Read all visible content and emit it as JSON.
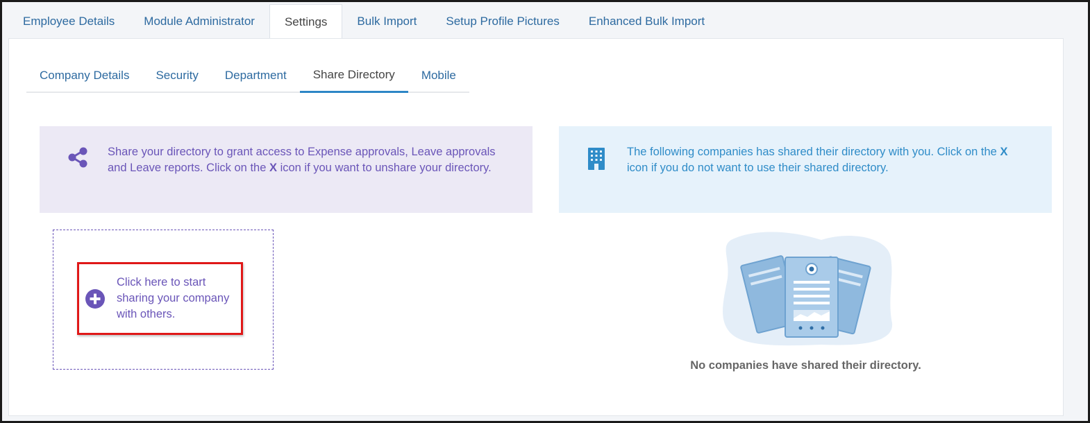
{
  "top_tabs": [
    {
      "label": "Employee Details",
      "active": false
    },
    {
      "label": "Module Administrator",
      "active": false
    },
    {
      "label": "Settings",
      "active": true
    },
    {
      "label": "Bulk Import",
      "active": false
    },
    {
      "label": "Setup Profile Pictures",
      "active": false
    },
    {
      "label": "Enhanced Bulk Import",
      "active": false
    }
  ],
  "sub_tabs": [
    {
      "label": "Company Details",
      "active": false
    },
    {
      "label": "Security",
      "active": false
    },
    {
      "label": "Department",
      "active": false
    },
    {
      "label": "Share Directory",
      "active": true
    },
    {
      "label": "Mobile",
      "active": false
    }
  ],
  "share_info": {
    "icon": "share-icon",
    "text_before": "Share your directory to grant access to Expense approvals, Leave approvals and Leave reports. Click on the ",
    "text_bold": "X",
    "text_after": " icon if you want to unshare your directory."
  },
  "shared_with_info": {
    "icon": "building-icon",
    "text_before": "The following companies has shared their directory with you. Click on the ",
    "text_bold": "X",
    "text_after": " icon if you do not want to use their shared directory."
  },
  "add_share": {
    "icon": "plus-circle-icon",
    "label": "Click here to start sharing your company with others."
  },
  "empty_state": {
    "illustration": "documents-illustration",
    "text": "No companies have shared their directory."
  },
  "colors": {
    "tab_link": "#2d6aa0",
    "purple_accent": "#6a55b8",
    "blue_accent": "#2f8cc8",
    "highlight_red": "#e01818"
  }
}
